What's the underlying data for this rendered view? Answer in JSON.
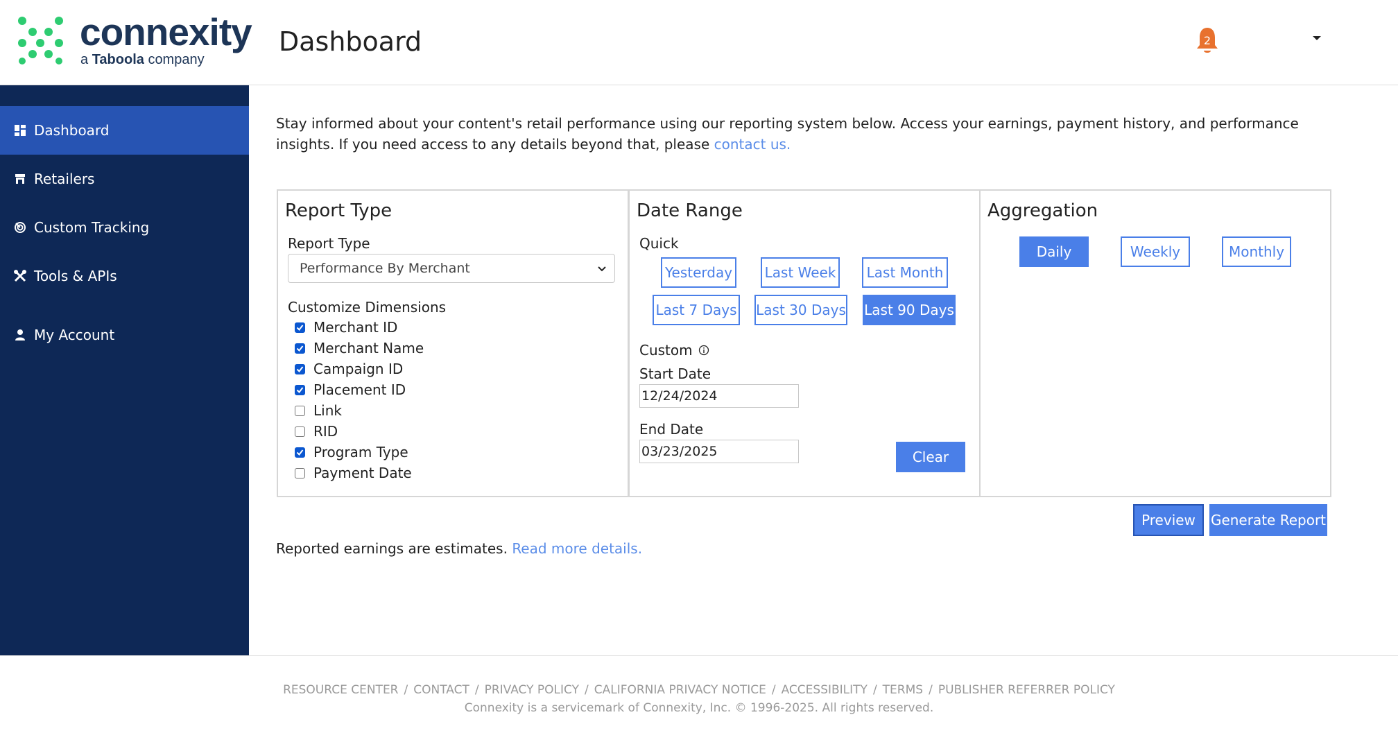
{
  "brand": {
    "name": "connexity",
    "tagline_prefix": "a",
    "tagline_brand": "Taboola",
    "tagline_suffix": "company"
  },
  "header": {
    "title": "Dashboard",
    "notifications_count": "2"
  },
  "sidebar": {
    "items": [
      {
        "label": "Dashboard",
        "icon": "dashboard-icon",
        "active": true
      },
      {
        "label": "Retailers",
        "icon": "store-icon"
      },
      {
        "label": "Custom Tracking",
        "icon": "tracking-icon"
      },
      {
        "label": "Tools & APIs",
        "icon": "tools-icon"
      },
      {
        "label": "My Account",
        "icon": "person-icon"
      }
    ]
  },
  "intro": {
    "text": "Stay informed about your content's retail performance using our reporting system below. Access your earnings, payment history, and performance insights. If you need access to any details beyond that, please ",
    "link": "contact us."
  },
  "report_type": {
    "title": "Report Type",
    "select_label": "Report Type",
    "select_value": "Performance By Merchant",
    "dimensions_label": "Customize Dimensions",
    "dimensions": [
      {
        "label": "Merchant ID",
        "checked": true
      },
      {
        "label": "Merchant Name",
        "checked": true
      },
      {
        "label": "Campaign ID",
        "checked": true
      },
      {
        "label": "Placement ID",
        "checked": true
      },
      {
        "label": "Link",
        "checked": false
      },
      {
        "label": "RID",
        "checked": false
      },
      {
        "label": "Program Type",
        "checked": true
      },
      {
        "label": "Payment Date",
        "checked": false
      }
    ]
  },
  "date_range": {
    "title": "Date Range",
    "quick_label": "Quick",
    "quick": [
      "Yesterday",
      "Last Week",
      "Last Month",
      "Last 7 Days",
      "Last 30 Days",
      "Last 90 Days"
    ],
    "quick_selected": "Last 90 Days",
    "custom_label": "Custom",
    "start_label": "Start Date",
    "start_value": "12/24/2024",
    "end_label": "End Date",
    "end_value": "03/23/2025",
    "clear": "Clear"
  },
  "aggregation": {
    "title": "Aggregation",
    "options": [
      "Daily",
      "Weekly",
      "Monthly"
    ],
    "selected": "Daily"
  },
  "actions": {
    "preview": "Preview",
    "generate": "Generate Report"
  },
  "note": {
    "text": "Reported earnings are estimates. ",
    "link": "Read more details."
  },
  "footer": {
    "links": [
      "RESOURCE CENTER",
      "CONTACT",
      "PRIVACY POLICY",
      "CALIFORNIA PRIVACY NOTICE",
      "ACCESSIBILITY",
      "TERMS",
      "PUBLISHER REFERRER POLICY"
    ],
    "separator": "/",
    "copyright": "Connexity is a servicemark of Connexity, Inc. © 1996-2025. All rights reserved."
  },
  "colors": {
    "sidebar": "#0e2856",
    "sidebar_active": "#2754b3",
    "accent": "#4a7fe8",
    "link": "#5b8de8",
    "bell": "#e8712e",
    "logo_dots": "#2ecc71",
    "logo_text": "#1d3557"
  }
}
